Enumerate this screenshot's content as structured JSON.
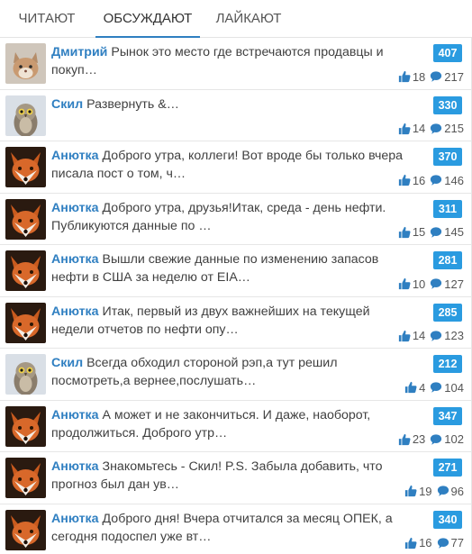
{
  "tabs": [
    {
      "label": "ЧИТАЮТ"
    },
    {
      "label": "ОБСУЖДАЮТ"
    },
    {
      "label": "ЛАЙКАЮТ"
    }
  ],
  "active_tab": "ОБСУЖДАЮТ",
  "colors": {
    "accent": "#2f7fc1",
    "badge": "#2a9be0"
  },
  "icons": {
    "like": "thumbs-up-icon",
    "comment": "comment-bubble-icon"
  },
  "posts": [
    {
      "author": "Дмитрий",
      "avatar": "cat",
      "text": "Рынок это место где встречаются продавцы и покуп…",
      "comments": "407",
      "likes": "18",
      "views": "217"
    },
    {
      "author": "Скил",
      "avatar": "owl",
      "text": "Развернуть &…",
      "comments": "330",
      "likes": "14",
      "views": "215"
    },
    {
      "author": "Анютка",
      "avatar": "fox",
      "text": "Доброго утра, коллеги! Вот вроде бы только вчера писала пост о том, ч…",
      "comments": "370",
      "likes": "16",
      "views": "146"
    },
    {
      "author": "Анютка",
      "avatar": "fox",
      "text": "Доброго утра, друзья!Итак, среда - день нефти. Публикуются данные по …",
      "comments": "311",
      "likes": "15",
      "views": "145"
    },
    {
      "author": "Анютка",
      "avatar": "fox",
      "text": "Вышли свежие данные по изменению запасов нефти в США за неделю от EIA…",
      "comments": "281",
      "likes": "10",
      "views": "127"
    },
    {
      "author": "Анютка",
      "avatar": "fox",
      "text": "Итак, первый из двух важнейших на текущей недели отчетов по нефти опу…",
      "comments": "285",
      "likes": "14",
      "views": "123"
    },
    {
      "author": "Скил",
      "avatar": "owl",
      "text": "Всегда обходил стороной рэп,а тут решил посмотреть,а вернее,послушать…",
      "comments": "212",
      "likes": "4",
      "views": "104"
    },
    {
      "author": "Анютка",
      "avatar": "fox",
      "text": "А может и не закончиться. И даже, наоборот, продолжиться. Доброго утр…",
      "comments": "347",
      "likes": "23",
      "views": "102"
    },
    {
      "author": "Анютка",
      "avatar": "fox",
      "text": "Знакомьтесь - Скил! P.S. Забыла добавить, что прогноз был дан ув…",
      "comments": "271",
      "likes": "19",
      "views": "96"
    },
    {
      "author": "Анютка",
      "avatar": "fox",
      "text": "Доброго дня! Вчера отчитался за месяц ОПЕК, а сегодня подоспел уже вт…",
      "comments": "340",
      "likes": "16",
      "views": "77"
    }
  ]
}
